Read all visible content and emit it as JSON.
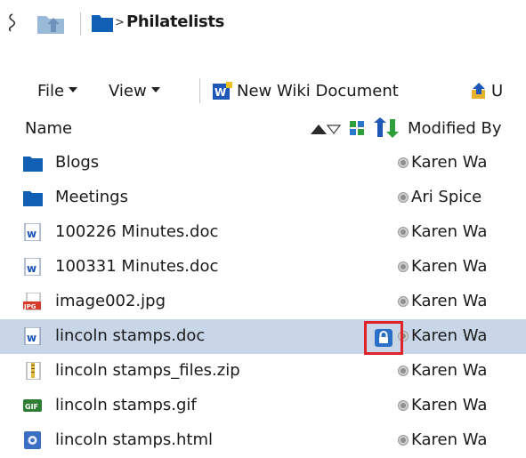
{
  "breadcrumb": {
    "separator": ">",
    "current": "Philatelists"
  },
  "toolbar": {
    "file_label": "File",
    "view_label": "View",
    "new_wiki_label": "New Wiki Document",
    "upload_label": "U"
  },
  "columns": {
    "name": "Name",
    "modified_by": "Modified By"
  },
  "rows": [
    {
      "name": "Blogs",
      "type": "folder-icon",
      "user": "Karen Wa"
    },
    {
      "name": "Meetings",
      "type": "folder-icon",
      "user": "Ari Spice"
    },
    {
      "name": "100226 Minutes.doc",
      "type": "word-doc-icon",
      "user": "Karen Wa"
    },
    {
      "name": "100331 Minutes.doc",
      "type": "word-doc-icon",
      "user": "Karen Wa"
    },
    {
      "name": "image002.jpg",
      "type": "jpg-file-icon",
      "user": "Karen Wa"
    },
    {
      "name": "lincoln stamps.doc",
      "type": "word-doc-icon",
      "user": "Karen Wa",
      "selected": true,
      "locked": true
    },
    {
      "name": "lincoln stamps_files.zip",
      "type": "zip-file-icon",
      "user": "Karen Wa"
    },
    {
      "name": "lincoln stamps.gif",
      "type": "gif-file-icon",
      "user": "Karen Wa"
    },
    {
      "name": "lincoln stamps.html",
      "type": "html-file-icon",
      "user": "Karen Wa"
    }
  ],
  "colors": {
    "selection": "#c9d6e8",
    "highlight_box": "#e0232a",
    "folder": "#0f5fb4",
    "lock": "#2a70c9"
  }
}
